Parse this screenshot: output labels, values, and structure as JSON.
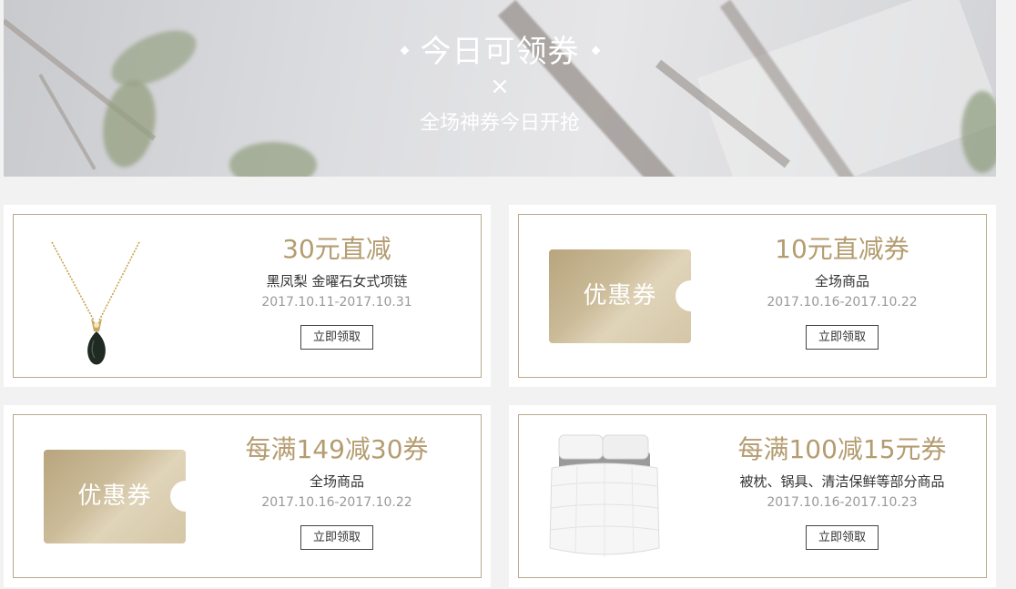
{
  "banner": {
    "title": "今日可领券",
    "x_mark": "×",
    "subtitle": "全场神券今日开抢"
  },
  "coupons": [
    {
      "title": "30元直减",
      "desc": "黑凤梨 金曜石女式项链",
      "date": "2017.10.11-2017.10.31",
      "button": "立即领取",
      "image": "necklace-image"
    },
    {
      "title": "10元直减券",
      "desc": "全场商品",
      "date": "2017.10.16-2017.10.22",
      "button": "立即领取",
      "voucher_label": "优惠券"
    },
    {
      "title": "每满149减30券",
      "desc": "全场商品",
      "date": "2017.10.16-2017.10.22",
      "button": "立即领取",
      "voucher_label": "优惠券"
    },
    {
      "title": "每满100减15元券",
      "desc": "被枕、锅具、清洁保鲜等部分商品",
      "date": "2017.10.16-2017.10.23",
      "button": "立即领取",
      "image": "bedding-image"
    }
  ],
  "colors": {
    "accent": "#b49c70",
    "border": "#b7a98a",
    "voucher_gold": "#cbbb98",
    "page_bg": "#f2f2f2"
  }
}
